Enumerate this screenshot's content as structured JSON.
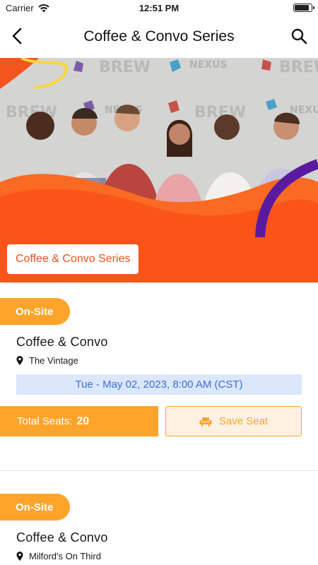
{
  "status_bar": {
    "carrier": "Carrier",
    "time": "12:51 PM"
  },
  "nav": {
    "title": "Coffee & Convo Series",
    "back_icon": "chevron-left-icon",
    "search_icon": "search-icon"
  },
  "hero": {
    "logos": [
      "BREW",
      "NEXUS"
    ]
  },
  "series_chip": "Coffee & Convo Series",
  "events": [
    {
      "badge": "On-Site",
      "title": "Coffee & Convo",
      "venue": "The Vintage",
      "date": "Tue - May 02, 2023, 8:00 AM (CST)",
      "seats_label": "Total Seats:",
      "seats_value": "20",
      "save_label": "Save Seat"
    },
    {
      "badge": "On-Site",
      "title": "Coffee & Convo",
      "venue": "Milford's On Third"
    }
  ],
  "colors": {
    "accent_orange": "#fb5418",
    "badge_amber": "#ffa42b",
    "date_blue": "#3e6ed6",
    "date_bg": "#dbe7fb"
  }
}
